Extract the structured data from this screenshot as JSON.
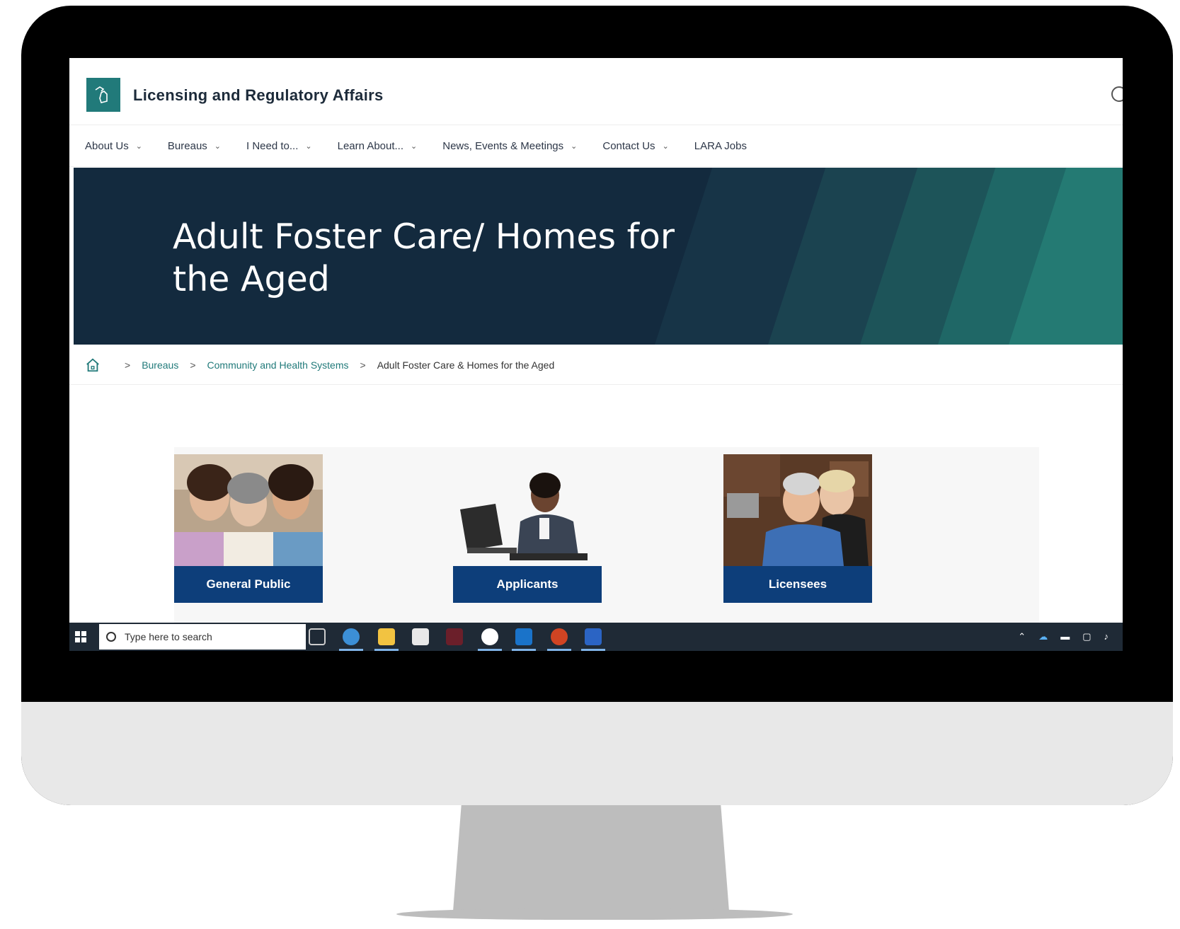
{
  "header": {
    "site_title": "Licensing and Regulatory Affairs"
  },
  "nav": {
    "items": [
      {
        "label": "About Us",
        "has_dropdown": true
      },
      {
        "label": "Bureaus",
        "has_dropdown": true
      },
      {
        "label": "I Need to...",
        "has_dropdown": true
      },
      {
        "label": "Learn About...",
        "has_dropdown": true
      },
      {
        "label": "News, Events & Meetings",
        "has_dropdown": true
      },
      {
        "label": "Contact Us",
        "has_dropdown": true
      },
      {
        "label": "LARA Jobs",
        "has_dropdown": false
      }
    ],
    "chevron": "⌄"
  },
  "hero": {
    "title": "Adult Foster Care/ Homes for the Aged"
  },
  "breadcrumb": {
    "separator": ">",
    "items": [
      {
        "label": "Bureaus",
        "link": true
      },
      {
        "label": "Community and Health Systems",
        "link": true
      },
      {
        "label": "Adult Foster Care & Homes for the Aged",
        "link": false
      }
    ]
  },
  "cards": [
    {
      "label": "General Public"
    },
    {
      "label": "Applicants"
    },
    {
      "label": "Licensees"
    }
  ],
  "taskbar": {
    "search_placeholder": "Type here to search"
  },
  "colors": {
    "brand_teal": "#217a7a",
    "hero_navy": "#132a3e",
    "card_label_blue": "#0d3e7a",
    "taskbar": "#1f2a36"
  }
}
